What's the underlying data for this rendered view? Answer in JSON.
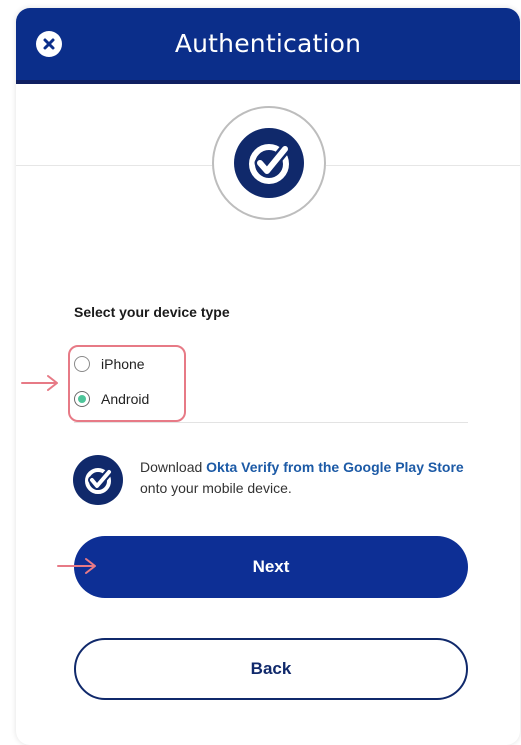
{
  "header": {
    "title": "Authentication",
    "close_icon": "close-icon",
    "background_color": "#0b2e8a"
  },
  "logo": {
    "icon": "okta-verify-check-icon"
  },
  "device_select": {
    "label": "Select your device type",
    "options": [
      {
        "label": "iPhone",
        "selected": false
      },
      {
        "label": "Android",
        "selected": true
      }
    ],
    "accent_color": "#4ec59a"
  },
  "info": {
    "icon": "okta-verify-check-icon",
    "text_before": "Download ",
    "link_text": "Okta Verify from the Google Play Store",
    "text_after": " onto your mobile device."
  },
  "buttons": {
    "next_label": "Next",
    "back_label": "Back"
  },
  "annotations": {
    "arrow_color": "#e77a86",
    "highlight_color": "#e77a86"
  }
}
